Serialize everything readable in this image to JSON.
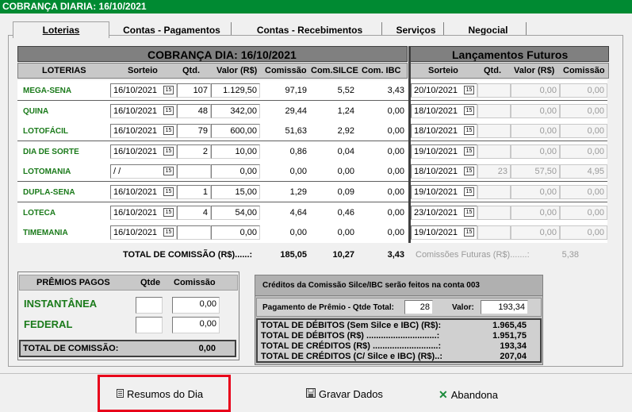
{
  "window": {
    "title": "COBRANÇA DIARIA: 16/10/2021"
  },
  "tabs": [
    "Loterias",
    "Contas - Pagamentos",
    "Contas - Recebimentos",
    "Serviços",
    "Negocial"
  ],
  "main": {
    "header_title": "COBRANÇA DIA: 16/10/2021",
    "future_title": "Lançamentos Futuros",
    "col": {
      "loterias": "LOTERIAS",
      "sorteio": "Sorteio",
      "qtd": "Qtd.",
      "valor": "Valor (R$)",
      "comissao": "Comissão",
      "com_silce": "Com.SILCE",
      "com_ibc": "Com. IBC"
    },
    "fcol": {
      "sorteio": "Sorteio",
      "qtd": "Qtd.",
      "valor": "Valor (R$)",
      "comissao": "Comissão"
    },
    "rows": [
      {
        "name": "MEGA-SENA",
        "sorteio": "16/10/2021",
        "qtd": "107",
        "valor": "1.129,50",
        "comissao": "97,19",
        "silce": "5,52",
        "ibc": "3,43",
        "f_sorteio": "20/10/2021",
        "f_qtd": "",
        "f_valor": "0,00",
        "f_comissao": "0,00"
      },
      {
        "name": "QUINA",
        "sorteio": "16/10/2021",
        "qtd": "48",
        "valor": "342,00",
        "comissao": "29,44",
        "silce": "1,24",
        "ibc": "0,00",
        "f_sorteio": "18/10/2021",
        "f_qtd": "",
        "f_valor": "0,00",
        "f_comissao": "0,00"
      },
      {
        "name": "LOTOFÁCIL",
        "sorteio": "16/10/2021",
        "qtd": "79",
        "valor": "600,00",
        "comissao": "51,63",
        "silce": "2,92",
        "ibc": "0,00",
        "f_sorteio": "18/10/2021",
        "f_qtd": "",
        "f_valor": "0,00",
        "f_comissao": "0,00"
      },
      {
        "name": "DIA DE SORTE",
        "sorteio": "16/10/2021",
        "qtd": "2",
        "valor": "10,00",
        "comissao": "0,86",
        "silce": "0,04",
        "ibc": "0,00",
        "f_sorteio": "19/10/2021",
        "f_qtd": "",
        "f_valor": "0,00",
        "f_comissao": "0,00"
      },
      {
        "name": "LOTOMANIA",
        "sorteio": "  /  /",
        "qtd": "",
        "valor": "0,00",
        "comissao": "0,00",
        "silce": "0,00",
        "ibc": "0,00",
        "f_sorteio": "18/10/2021",
        "f_qtd": "23",
        "f_valor": "57,50",
        "f_comissao": "4,95"
      },
      {
        "name": "DUPLA-SENA",
        "sorteio": "16/10/2021",
        "qtd": "1",
        "valor": "15,00",
        "comissao": "1,29",
        "silce": "0,09",
        "ibc": "0,00",
        "f_sorteio": "19/10/2021",
        "f_qtd": "",
        "f_valor": "0,00",
        "f_comissao": "0,00"
      },
      {
        "name": "LOTECA",
        "sorteio": "16/10/2021",
        "qtd": "4",
        "valor": "54,00",
        "comissao": "4,64",
        "silce": "0,46",
        "ibc": "0,00",
        "f_sorteio": "23/10/2021",
        "f_qtd": "",
        "f_valor": "0,00",
        "f_comissao": "0,00"
      },
      {
        "name": "TIMEMANIA",
        "sorteio": "16/10/2021",
        "qtd": "",
        "valor": "0,00",
        "comissao": "0,00",
        "silce": "0,00",
        "ibc": "0,00",
        "f_sorteio": "19/10/2021",
        "f_qtd": "",
        "f_valor": "0,00",
        "f_comissao": "0,00"
      }
    ],
    "totals": {
      "label": "TOTAL DE COMISSÃO (R$)......:",
      "comissao": "185,05",
      "silce": "10,27",
      "ibc": "3,43",
      "futuras_label": "Comissões Futuras (R$).......:",
      "futuras": "5,38"
    }
  },
  "premios": {
    "title": "PRÊMIOS PAGOS",
    "qtde": "Qtde",
    "comissao": "Comissão",
    "rows": [
      {
        "name": "INSTANTÂNEA",
        "qtde": "",
        "comissao": "0,00"
      },
      {
        "name": "FEDERAL",
        "qtde": "",
        "comissao": "0,00"
      }
    ],
    "total_label": "TOTAL DE COMISSÃO:",
    "total": "0,00"
  },
  "summary": {
    "note": "Créditos da Comissão Silce/IBC serão feitos na conta 003",
    "pag_label": "Pagamento de Prêmio - Qtde Total:",
    "pag_qtde": "28",
    "valor_label": "Valor:",
    "pag_valor": "193,34",
    "lines": [
      {
        "label": "TOTAL DE DÉBITOS (Sem Silce e IBC) (R$):",
        "value": "1.965,45"
      },
      {
        "label": "TOTAL DE DÉBITOS (R$) .............................:",
        "value": "1.951,75"
      },
      {
        "label": "TOTAL DE CRÉDITOS (R$) ...........................:",
        "value": "193,34"
      },
      {
        "label": "TOTAL DE CRÉDITOS (C/ Silce e IBC) (R$)..:",
        "value": "207,04"
      }
    ]
  },
  "buttons": {
    "resumos": "Resumos do Dia",
    "gravar": "Gravar Dados",
    "abandona": "Abandona"
  },
  "icons": {
    "calendar": "calendar-icon",
    "document": "document-icon",
    "save": "save-icon",
    "cancel": "x-icon"
  },
  "colors": {
    "title_bar": "#008a32",
    "lottery_green": "#1a7a1a",
    "highlight": "#e8001a"
  }
}
